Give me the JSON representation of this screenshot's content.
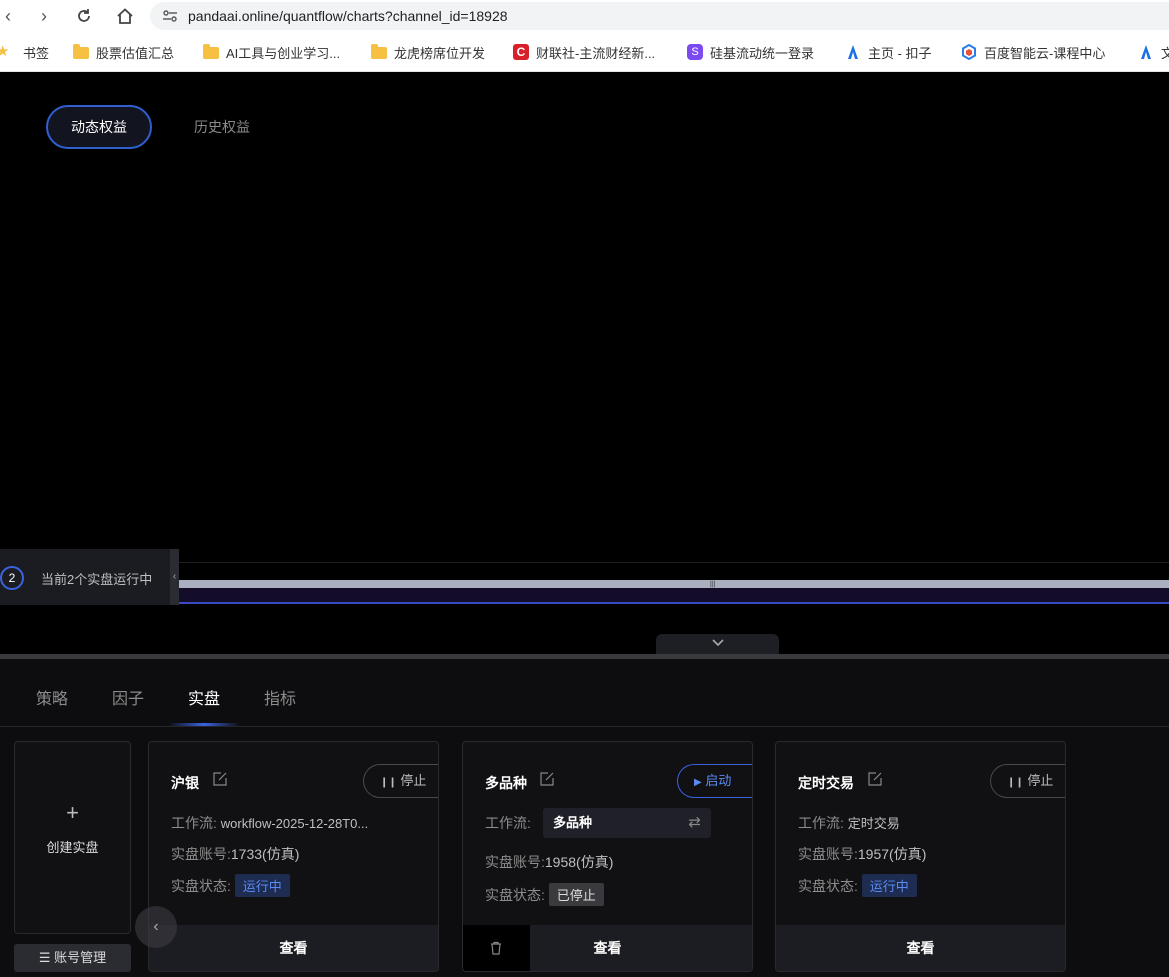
{
  "browser": {
    "url": "pandaai.online/quantflow/charts?channel_id=18928",
    "bookmarks": [
      "书签",
      "股票估值汇总",
      "AI工具与创业学习...",
      "龙虎榜席位开发",
      "财联社-主流财经新...",
      "硅基流动统一登录",
      "主页 - 扣子",
      "百度智能云-课程中心",
      "文"
    ]
  },
  "top_tabs": {
    "active": "动态权益",
    "other": "历史权益"
  },
  "running": {
    "count": "2",
    "text": "当前2个实盘运行中"
  },
  "sub_tabs": [
    "策略",
    "因子",
    "实盘",
    "指标"
  ],
  "create": {
    "label": "创建实盘",
    "plus": "+"
  },
  "account_btn": "账号管理",
  "cards": [
    {
      "title": "沪银",
      "action": "停止",
      "wf_label": "工作流:",
      "wf_value": "workflow-2025-12-28T0...",
      "acct_label": "实盘账号:",
      "acct_value": "1733(仿真)",
      "status_label": "实盘状态:",
      "status": "运行中",
      "view": "查看"
    },
    {
      "title": "多品种",
      "action": "启动",
      "wf_label": "工作流:",
      "wf_value": "多品种",
      "acct_label": "实盘账号:",
      "acct_value": "1958(仿真)",
      "status_label": "实盘状态:",
      "status": "已停止",
      "view": "查看"
    },
    {
      "title": "定时交易",
      "action": "停止",
      "wf_label": "工作流:",
      "wf_value": "定时交易",
      "acct_label": "实盘账号:",
      "acct_value": "1957(仿真)",
      "status_label": "实盘状态:",
      "status": "运行中",
      "view": "查看"
    }
  ],
  "colors": {
    "accent": "#3a63e0",
    "bg": "#000000",
    "panel": "#0d0d0f"
  }
}
